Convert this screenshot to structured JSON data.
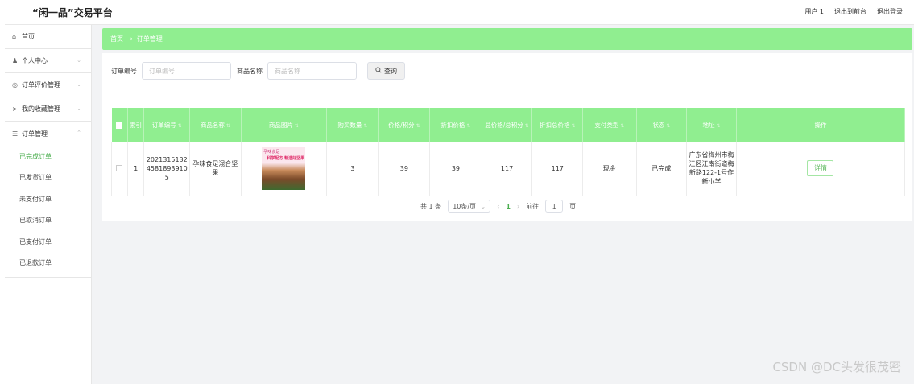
{
  "header": {
    "brand": "“闲一品”交易平台",
    "links": [
      "用户 1",
      "退出到前台",
      "退出登录"
    ]
  },
  "sidebar": {
    "items": [
      {
        "icon": "home-icon",
        "glyph": "⌂",
        "label": "首页",
        "chevron": ""
      },
      {
        "icon": "user-icon",
        "glyph": "♟",
        "label": "个人中心",
        "chevron": "⌄"
      },
      {
        "icon": "comment-icon",
        "glyph": "◎",
        "label": "订单评价管理",
        "chevron": "⌄"
      },
      {
        "icon": "send-icon",
        "glyph": "➤",
        "label": "我的收藏管理",
        "chevron": "⌄"
      },
      {
        "icon": "list-icon",
        "glyph": "☰",
        "label": "订单管理",
        "chevron": "⌃"
      }
    ],
    "subitems": [
      "已完成订单",
      "已发货订单",
      "未支付订单",
      "已取消订单",
      "已支付订单",
      "已退款订单"
    ],
    "active_subitem": "已完成订单"
  },
  "breadcrumb": {
    "home": "首页",
    "separator": "→",
    "current": "订单管理"
  },
  "search": {
    "order_label": "订单编号",
    "order_placeholder": "订单编号",
    "product_label": "商品名称",
    "product_placeholder": "商品名称",
    "button_icon": "search-icon",
    "button_label": "查询"
  },
  "table": {
    "columns": [
      "索引",
      "订单编号",
      "商品名称",
      "商品图片",
      "购买数量",
      "价格/积分",
      "折扣价格",
      "总价格/总积分",
      "折扣总价格",
      "支付类型",
      "状态",
      "地址",
      "操作"
    ],
    "rows": [
      {
        "index": "1",
        "order_no": "202131513245818939105",
        "product": "孕味食足混合坚果",
        "image_text_1": "孕味食足",
        "image_text_2": "科学配方 精选好坚果",
        "qty": "3",
        "price": "39",
        "discount_price": "39",
        "total": "117",
        "discount_total": "117",
        "pay_type": "现金",
        "status": "已完成",
        "address": "广东省梅州市梅江区江南街道梅新路122-1号作新小学",
        "action": "详情"
      }
    ]
  },
  "pagination": {
    "total": "共 1 条",
    "page_size": "10条/页",
    "current_page": "1",
    "goto_label": "前往",
    "goto_value": "1",
    "page_suffix": "页"
  },
  "watermark": "CSDN @DC头发很茂密",
  "colors": {
    "accent": "#90ee90",
    "active": "#4caf50"
  }
}
